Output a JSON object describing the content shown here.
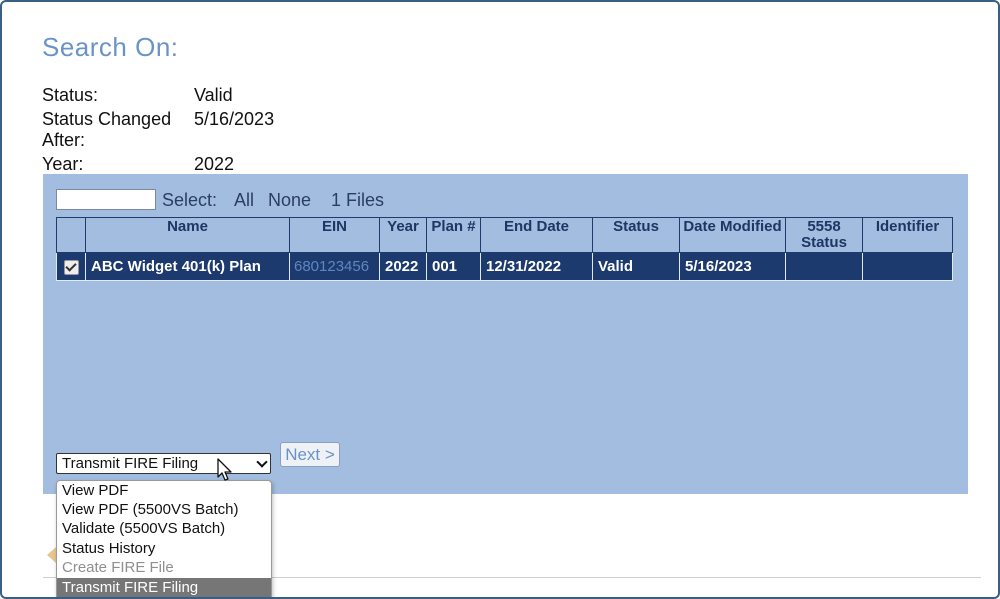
{
  "search": {
    "title": "Search On:",
    "criteria": [
      {
        "label": "Status:",
        "value": "Valid"
      },
      {
        "label": "Status Changed\nAfter:",
        "value": "5/16/2023"
      },
      {
        "label": "Year:",
        "value": "2022"
      }
    ]
  },
  "results": {
    "filter": {
      "value": "",
      "placeholder": ""
    },
    "select_label": "Select:",
    "select_all": "All",
    "select_none": "None",
    "file_count": "1 Files",
    "columns": [
      "",
      "Name",
      "EIN",
      "Year",
      "Plan #",
      "End Date",
      "Status",
      "Date Modified",
      "5558 Status",
      "Identifier"
    ],
    "rows": [
      {
        "checked": true,
        "name": "ABC Widget 401(k) Plan",
        "ein": "680123456",
        "year": "2022",
        "plan": "001",
        "end_date": "12/31/2022",
        "status": "Valid",
        "date_modified": "5/16/2023",
        "status_5558": "",
        "identifier": ""
      }
    ]
  },
  "action": {
    "selected": "Transmit FIRE Filing",
    "next_label": "Next >",
    "options": [
      {
        "label": "View PDF",
        "state": "normal"
      },
      {
        "label": "View PDF (5500VS Batch)",
        "state": "normal"
      },
      {
        "label": "Validate (5500VS Batch)",
        "state": "normal"
      },
      {
        "label": "Status History",
        "state": "normal"
      },
      {
        "label": "Create FIRE File",
        "state": "disabled"
      },
      {
        "label": "Transmit FIRE Filing",
        "state": "selected"
      }
    ]
  },
  "colors": {
    "panel": "#a3bde0",
    "row_selected": "#1c3a6e",
    "title": "#6b93c6",
    "link": "#5f86c1"
  }
}
